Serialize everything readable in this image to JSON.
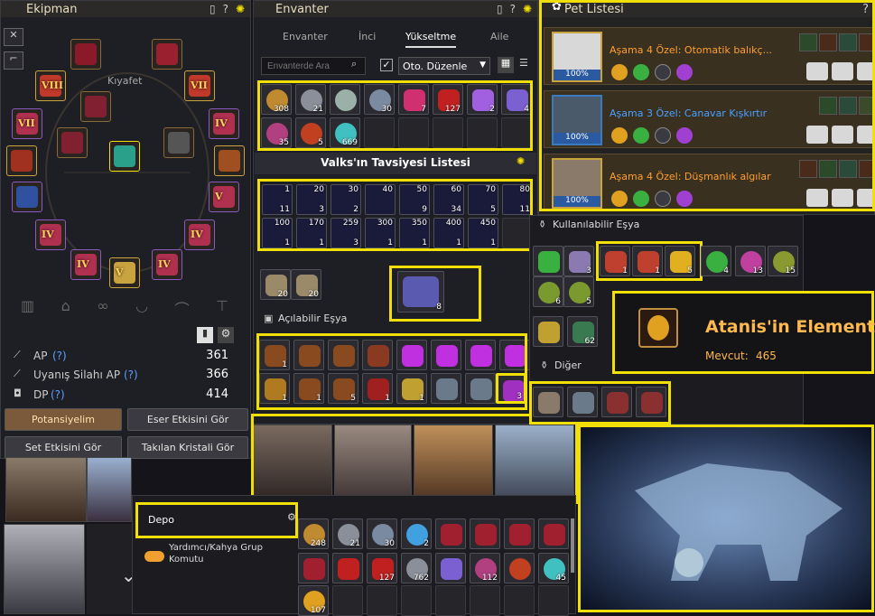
{
  "colors": {
    "highlight": "#f1e007",
    "gold": "#ffb84d",
    "panel": "#1e1f24",
    "titlebar": "#2b2a28",
    "pet_row": "#3a3020",
    "pct_bar": "#2c5aa0"
  },
  "ekipman": {
    "title": "Ekipman",
    "icons": [
      "document-icon",
      "help-icon",
      "settings-icon"
    ],
    "kiyafet": "Kıyafet",
    "circle_slots": [
      "VIII",
      "VII",
      "VII",
      "IV",
      "V",
      "V",
      "IV",
      "IV",
      "IV",
      "IV",
      "V",
      "IV"
    ],
    "stats": [
      {
        "label": "AP",
        "help": "(?)",
        "value": "361"
      },
      {
        "label": "Uyanış Silahı AP",
        "help": "(?)",
        "value": "366"
      },
      {
        "label": "DP",
        "help": "(?)",
        "value": "414"
      }
    ],
    "buttons": [
      "Potansiyelim",
      "Eser Etkisini Gör",
      "Set Etkisini Gör",
      "Takılan Kristali Gör"
    ]
  },
  "envanter": {
    "title": "Envanter",
    "tabs": [
      "Envanter",
      "İnci",
      "Yükseltme",
      "Aile"
    ],
    "active_tab": "Yükseltme",
    "search_placeholder": "Envanterde Ara",
    "auto_sort_label": "Oto. Düzenle",
    "row1_counts": [
      "308",
      "21",
      "30",
      "30",
      "7",
      "127",
      "2",
      "4"
    ],
    "row2_counts": [
      "35",
      "5",
      "669"
    ],
    "valks_title": "Valks'ın Tavsiyesi Listesi",
    "valks_top": [
      "20",
      "30",
      "40",
      "50",
      "60",
      "70",
      "80"
    ],
    "valks_bottom": [
      "11",
      "3",
      "2",
      "9",
      "34",
      "5",
      "11"
    ],
    "valks2_top": [
      "100",
      "170",
      "259",
      "300",
      "350",
      "400",
      "450"
    ],
    "valks2_bottom": [
      "1",
      "1",
      "3",
      "1",
      "1",
      "1",
      "1"
    ],
    "misc_counts": [
      "20",
      "20",
      "8"
    ],
    "openable_title": "Açılabilir Eşya",
    "openable_row1": [
      "1",
      "",
      "",
      "",
      "",
      "",
      "",
      ""
    ],
    "openable_row2": [
      "1",
      "1",
      "5",
      "1",
      "1",
      "",
      "",
      "3"
    ]
  },
  "pets": {
    "title": "Pet Listesi",
    "help": "?",
    "list": [
      {
        "stage_label": "Aşama",
        "stage_num": "4",
        "special_label": "Özel:",
        "special": "Otomatik balıkç...",
        "pct": "100%"
      },
      {
        "stage_label": "Aşama",
        "stage_num": "3",
        "special_label": "Özel:",
        "special": "Canavar Kışkırtır",
        "pct": "100%"
      },
      {
        "stage_label": "Aşama",
        "stage_num": "4",
        "special_label": "Özel:",
        "special": "Düşmanlık algılar",
        "pct": "100%"
      }
    ]
  },
  "usable": {
    "title": "Kullanılabilir Eşya",
    "counts": [
      "",
      "3",
      "1",
      "1",
      "5",
      "4",
      "13",
      "15",
      "",
      "",
      "6",
      "5",
      "",
      "62"
    ],
    "other_title": "Diğer"
  },
  "tooltip": {
    "name": "Atanis'in Elementi",
    "available_label": "Mevcut:",
    "available": "465"
  },
  "depo": {
    "title": "Depo",
    "toggle_label": "Yardımcı/Kahya Grup Komutu",
    "counts_row1": [
      "248",
      "21",
      "30",
      "2",
      "",
      "",
      "",
      ""
    ],
    "counts_row2": [
      "",
      "127",
      "762",
      "",
      "112",
      "",
      "45"
    ],
    "counts_row3": [
      "107"
    ]
  }
}
